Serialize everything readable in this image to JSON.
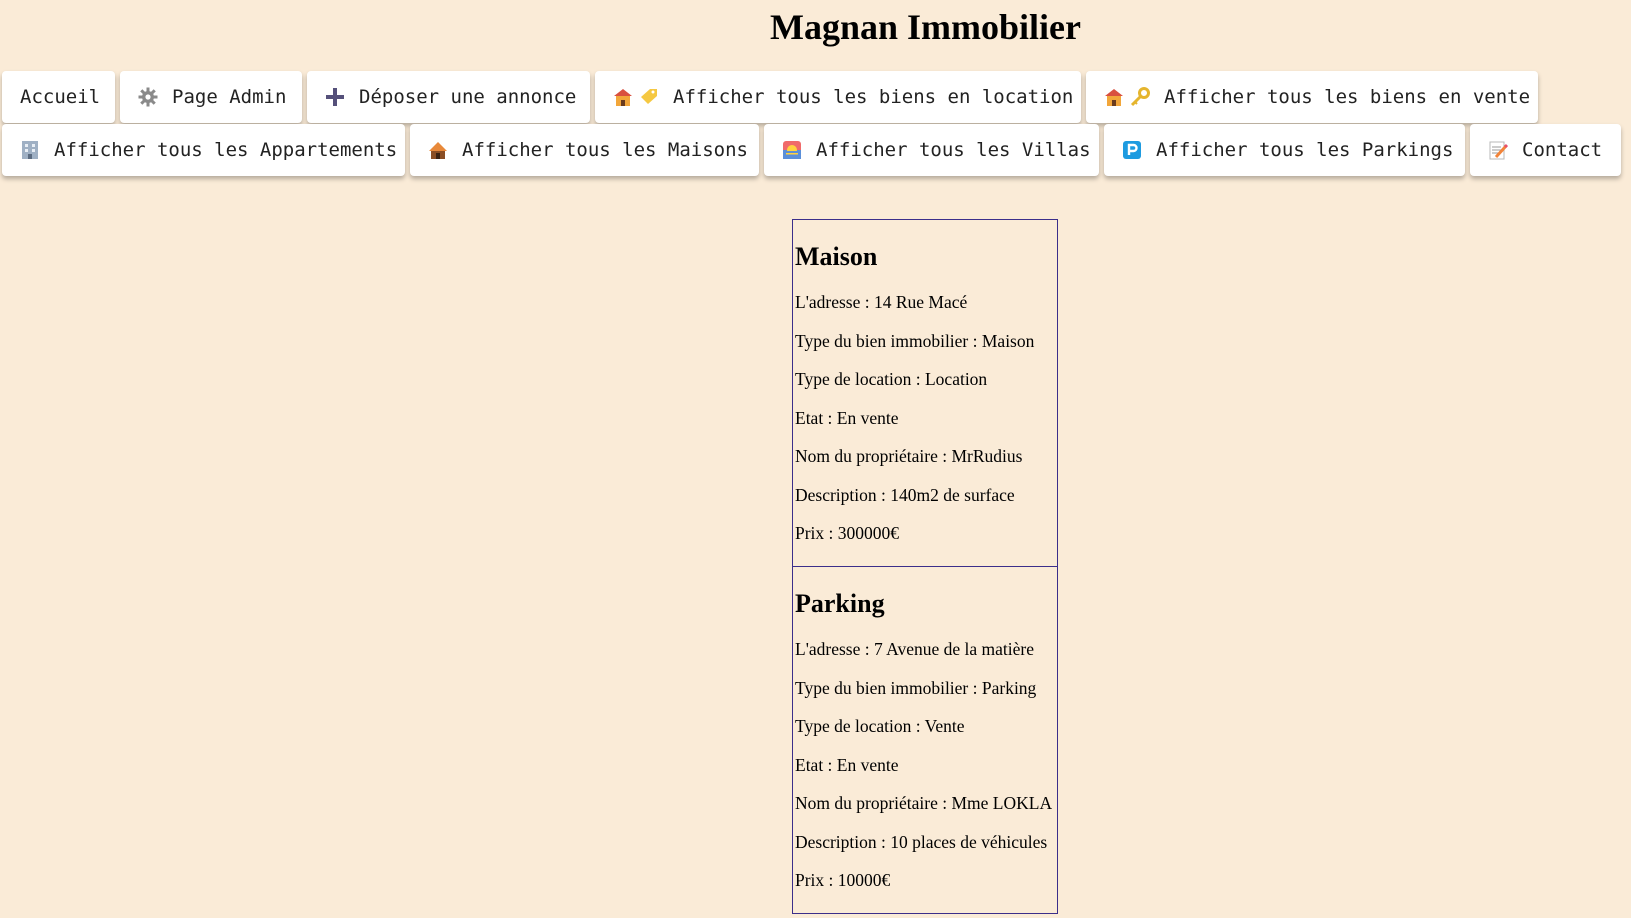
{
  "site_title": "Magnan Immobilier",
  "nav": {
    "row1": [
      {
        "label": "Accueil",
        "icon": ""
      },
      {
        "label": "Page Admin",
        "icon": "gear-icon"
      },
      {
        "label": "Déposer une annonce",
        "icon": "plus-icon"
      },
      {
        "label": "Afficher tous les biens en location",
        "icon": "house-tag-icon"
      },
      {
        "label": "Afficher tous les biens en vente",
        "icon": "house-key-icon"
      }
    ],
    "row2": [
      {
        "label": "Afficher tous les Appartements",
        "icon": "building-icon"
      },
      {
        "label": "Afficher tous les Maisons",
        "icon": "hut-icon"
      },
      {
        "label": "Afficher tous les Villas",
        "icon": "sunset-icon"
      },
      {
        "label": "Afficher tous les Parkings",
        "icon": "parking-icon"
      },
      {
        "label": "Contact",
        "icon": "memo-icon"
      }
    ]
  },
  "listings": [
    {
      "heading": "Maison",
      "lines": [
        "L'adresse : 14 Rue Macé",
        "Type du bien immobilier : Maison",
        "Type de location : Location",
        "Etat : En vente",
        "Nom du propriétaire : MrRudius",
        "Description : 140m2 de surface",
        "Prix : 300000€"
      ]
    },
    {
      "heading": "Parking",
      "lines": [
        "L'adresse : 7 Avenue de la matière",
        "Type du bien immobilier : Parking",
        "Type de location : Vente",
        "Etat : En vente",
        "Nom du propriétaire : Mme LOKLA",
        "Description : 10 places de véhicules",
        "Prix : 10000€"
      ]
    }
  ],
  "colors": {
    "background": "#faebd7",
    "card_border": "#3b2e8a",
    "button_bg": "#ffffff"
  }
}
